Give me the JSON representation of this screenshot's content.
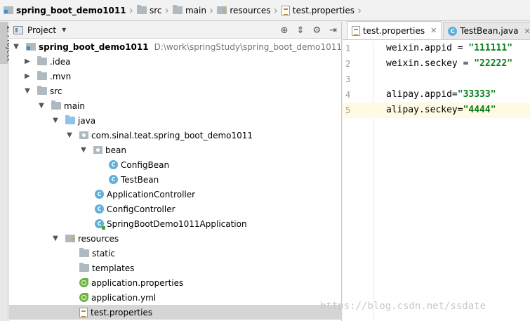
{
  "breadcrumb": [
    {
      "label": "spring_boot_demo1011",
      "icon": "module-icon"
    },
    {
      "label": "src",
      "icon": "folder-icon"
    },
    {
      "label": "main",
      "icon": "folder-icon"
    },
    {
      "label": "resources",
      "icon": "resources-folder-icon"
    },
    {
      "label": "test.properties",
      "icon": "properties-file-icon"
    }
  ],
  "left_strip": {
    "label": "1: Project"
  },
  "project_panel": {
    "title": "Project",
    "tools": [
      "target-icon",
      "collapse-icon",
      "gear-icon",
      "hide-icon"
    ]
  },
  "tree": [
    {
      "label": "spring_boot_demo1011",
      "path": "D:\\work\\springStudy\\spring_boot_demo1011",
      "icon": "module-icon",
      "arrow": "down"
    },
    {
      "label": ".idea",
      "icon": "folder-icon",
      "arrow": "right"
    },
    {
      "label": ".mvn",
      "icon": "folder-icon",
      "arrow": "right"
    },
    {
      "label": "src",
      "icon": "folder-icon",
      "arrow": "down"
    },
    {
      "label": "main",
      "icon": "folder-icon",
      "arrow": "down"
    },
    {
      "label": "java",
      "icon": "source-folder-icon",
      "arrow": "down"
    },
    {
      "label": "com.sinal.teat.spring_boot_demo1011",
      "icon": "package-icon",
      "arrow": "down"
    },
    {
      "label": "bean",
      "icon": "package-icon",
      "arrow": "down"
    },
    {
      "label": "ConfigBean",
      "icon": "class-icon",
      "arrow": ""
    },
    {
      "label": "TestBean",
      "icon": "class-icon",
      "arrow": ""
    },
    {
      "label": "ApplicationController",
      "icon": "class-icon",
      "arrow": ""
    },
    {
      "label": "ConfigController",
      "icon": "class-icon",
      "arrow": ""
    },
    {
      "label": "SpringBootDemo1011Application",
      "icon": "application-class-icon",
      "arrow": ""
    },
    {
      "label": "resources",
      "icon": "resources-folder-icon",
      "arrow": "down"
    },
    {
      "label": "static",
      "icon": "folder-icon",
      "arrow": ""
    },
    {
      "label": "templates",
      "icon": "folder-icon",
      "arrow": ""
    },
    {
      "label": "application.properties",
      "icon": "spring-config-icon",
      "arrow": ""
    },
    {
      "label": "application.yml",
      "icon": "spring-config-icon",
      "arrow": ""
    },
    {
      "label": "test.properties",
      "icon": "properties-file-icon",
      "arrow": "",
      "selected": true
    }
  ],
  "editor": {
    "tabs": [
      {
        "label": "test.properties",
        "active": true,
        "icon": "properties-file-icon"
      },
      {
        "label": "TestBean.java",
        "active": false,
        "icon": "class-icon"
      }
    ],
    "lines": [
      {
        "n": "1",
        "key": "weixin.appid",
        "op": " = ",
        "val": "\"111111\""
      },
      {
        "n": "2",
        "key": "weixin.seckey",
        "op": " = ",
        "val": "\"22222\""
      },
      {
        "n": "3",
        "key": "",
        "op": "",
        "val": ""
      },
      {
        "n": "4",
        "key": "alipay.appid",
        "op": "=",
        "val": "\"33333\""
      },
      {
        "n": "5",
        "key": "alipay.seckey",
        "op": "=",
        "val": "\"4444\"",
        "current": true
      }
    ]
  },
  "watermark": "https://blog.csdn.net/ssdate"
}
